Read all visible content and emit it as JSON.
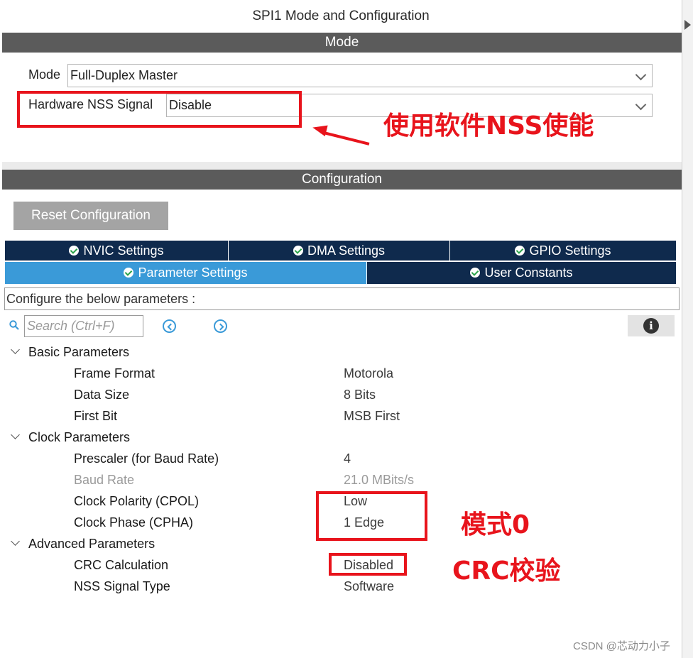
{
  "window_title": "SPI1 Mode and Configuration",
  "mode_section": {
    "header": "Mode",
    "mode_label": "Mode",
    "mode_value": "Full-Duplex Master",
    "nss_label": "Hardware NSS Signal",
    "nss_value": "Disable"
  },
  "config_section": {
    "header": "Configuration",
    "reset_button": "Reset Configuration",
    "tabs_row1": [
      "NVIC Settings",
      "DMA Settings",
      "GPIO Settings"
    ],
    "tabs_row2": [
      "Parameter Settings",
      "User Constants"
    ],
    "active_tab": "Parameter Settings",
    "configure_text": "Configure the below parameters :",
    "search_placeholder": "Search (Ctrl+F)"
  },
  "parameters": {
    "basic": {
      "title": "Basic Parameters",
      "items": [
        {
          "name": "Frame Format",
          "value": "Motorola"
        },
        {
          "name": "Data Size",
          "value": "8 Bits"
        },
        {
          "name": "First Bit",
          "value": "MSB First"
        }
      ]
    },
    "clock": {
      "title": "Clock Parameters",
      "items": [
        {
          "name": "Prescaler (for Baud Rate)",
          "value": "4"
        },
        {
          "name": "Baud Rate",
          "value": "21.0 MBits/s"
        },
        {
          "name": "Clock Polarity (CPOL)",
          "value": "Low"
        },
        {
          "name": "Clock Phase (CPHA)",
          "value": "1 Edge"
        }
      ]
    },
    "advanced": {
      "title": "Advanced Parameters",
      "items": [
        {
          "name": "CRC Calculation",
          "value": "Disabled"
        },
        {
          "name": "NSS Signal Type",
          "value": "Software"
        }
      ]
    }
  },
  "annotations": {
    "nss_note": "使用软件NSS使能",
    "mode_note": "模式0",
    "crc_note": "CRC校验",
    "accent_color": "#e8141c"
  },
  "watermark": "CSDN @芯动力小子",
  "colors": {
    "section_bar": "#5b5b5b",
    "tab_dark": "#0f2a4d",
    "tab_active": "#3a9ad8",
    "reset_button": "#a4a4a4"
  }
}
